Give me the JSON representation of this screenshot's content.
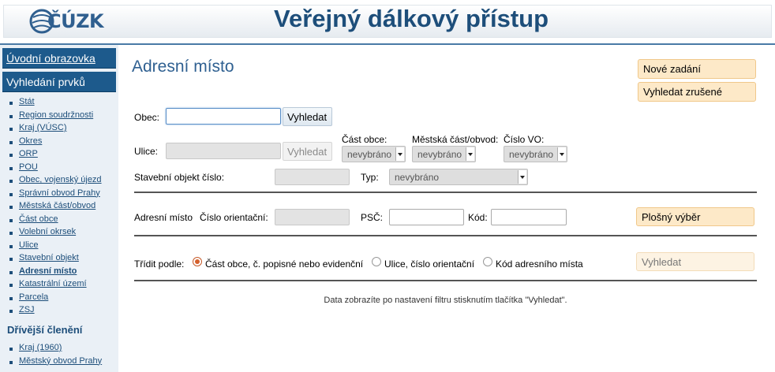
{
  "header": {
    "logo_text": "ČÚZK",
    "title": "Veřejný dálkový přístup"
  },
  "sidebar": {
    "home_label": "Úvodní obrazovka",
    "search_label": "Vyhledání prvků",
    "items": [
      "Stát",
      "Region soudržnosti",
      "Kraj (VÚSC)",
      "Okres",
      "ORP",
      "POU",
      "Obec, vojenský újezd",
      "Správní obvod Prahy",
      "Městská část/obvod",
      "Část obce",
      "Volební okrsek",
      "Ulice",
      "Stavební objekt",
      "Adresní místo",
      "Katastrální území",
      "Parcela",
      "ZSJ"
    ],
    "active_item": "Adresní místo",
    "former_section_label": "Dřívější členění",
    "former_items": [
      "Kraj (1960)",
      "Městský obvod Prahy"
    ]
  },
  "main": {
    "title": "Adresní místo",
    "new_entry_label": "Nové zadání",
    "search_cancelled_label": "Vyhledat zrušené",
    "obec_label": "Obec:",
    "obec_value": "",
    "obec_search_label": "Vyhledat",
    "ulice_label": "Ulice:",
    "ulice_search_label": "Vyhledat",
    "cast_obce_label": "Část obce:",
    "mestska_cast_label": "Městská část/obvod:",
    "cislo_vo_label": "Číslo VO:",
    "not_selected": "nevybráno",
    "stavebni_objekt_label": "Stavební objekt číslo:",
    "typ_label": "Typ:",
    "adresni_misto_label": "Adresní místo",
    "cislo_orientacni_label": "Číslo orientační:",
    "psc_label": "PSČ:",
    "kod_label": "Kód:",
    "area_select_label": "Plošný výběr",
    "sort_label": "Třídit podle:",
    "sort_options": [
      "Část obce, č. popisné nebo evidenční",
      "Ulice, číslo orientační",
      "Kód adresního místa"
    ],
    "sort_selected": "Část obce, č. popisné nebo evidenční",
    "search_label": "Vyhledat",
    "hint": "Data zobrazíte po nastavení filtru stisknutím tlačítka \"Vyhledat\"."
  },
  "colors": {
    "brand": "#1d5a8c",
    "title": "#1d4e7a",
    "accent_orange": "#fde9c8"
  }
}
